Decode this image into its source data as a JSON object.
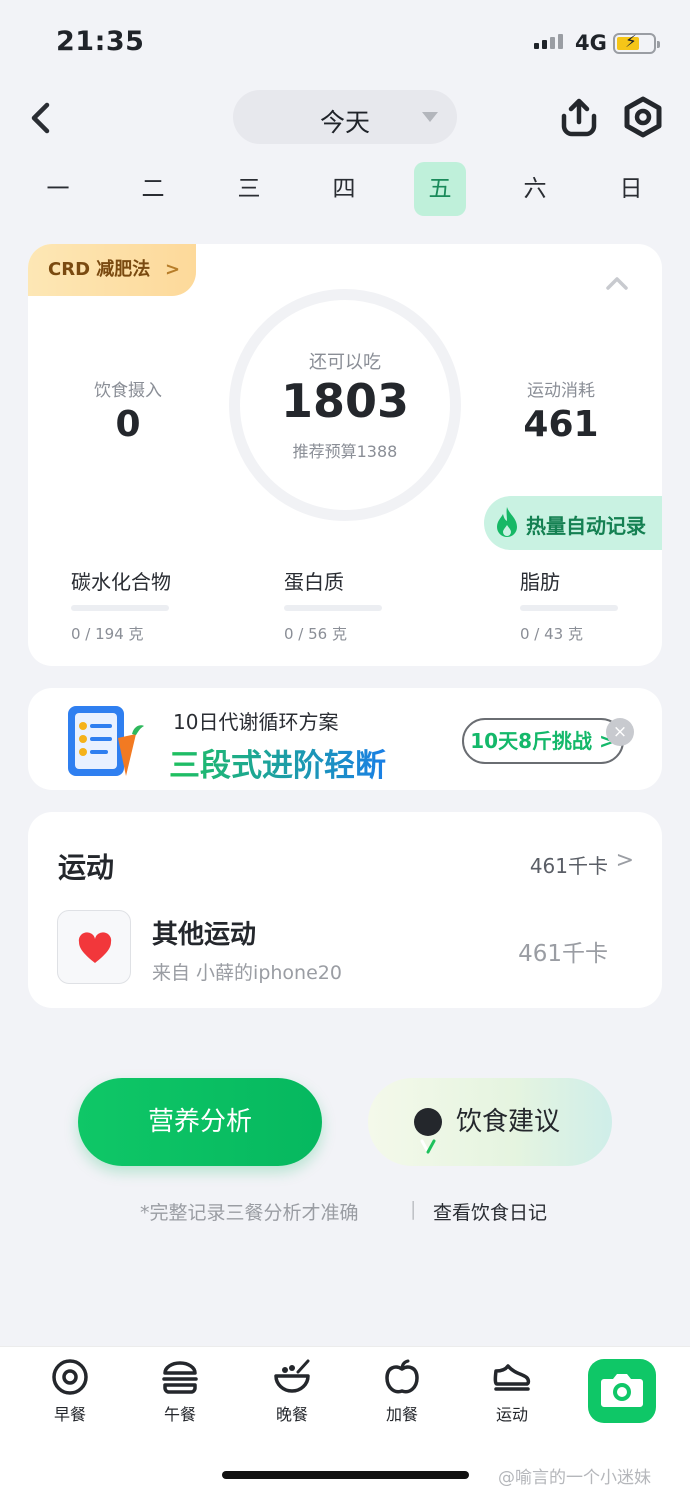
{
  "status_bar": {
    "time": "21:35",
    "network": "4G"
  },
  "header": {
    "date_label": "今天"
  },
  "week": {
    "days": [
      "一",
      "二",
      "三",
      "四",
      "五",
      "六",
      "日"
    ],
    "active_index": 4
  },
  "summary": {
    "plan_tag": "CRD 减肥法",
    "plan_chevron": ">",
    "remaining_label": "还可以吃",
    "remaining_value": "1803",
    "budget_text": "推荐预算1388",
    "intake_label": "饮食摄入",
    "intake_value": "0",
    "burn_label": "运动消耗",
    "burn_value": "461",
    "auto_record": "热量自动记录",
    "macros": [
      {
        "name": "碳水化合物",
        "amount": "0 / 194 克",
        "progress": 0
      },
      {
        "name": "蛋白质",
        "amount": "0 / 56 克",
        "progress": 0
      },
      {
        "name": "脂肪",
        "amount": "0 / 43 克",
        "progress": 0
      }
    ]
  },
  "promo": {
    "title": "10日代谢循环方案",
    "headline": "三段式进阶轻断",
    "button": "10天8斤挑战 >",
    "close": "×"
  },
  "exercise": {
    "title": "运动",
    "total": "461千卡",
    "total_chevron": ">",
    "item_name": "其他运动",
    "item_source": "来自 小薛的iphone20",
    "item_kcal": "461千卡"
  },
  "actions": {
    "analysis": "营养分析",
    "advice": "饮食建议",
    "hint": "*完整记录三餐分析才准确",
    "separator": "|",
    "diary_link": "查看饮食日记"
  },
  "tabbar": {
    "items": [
      "早餐",
      "午餐",
      "晚餐",
      "加餐",
      "运动"
    ],
    "watermark": "@喻言的一个小迷妹"
  },
  "colors": {
    "accent_green": "#0fc767",
    "page_bg": "#f2f3f7",
    "tag_bg": "#fde7b5",
    "auto_record_bg": "#c9f2e2"
  }
}
